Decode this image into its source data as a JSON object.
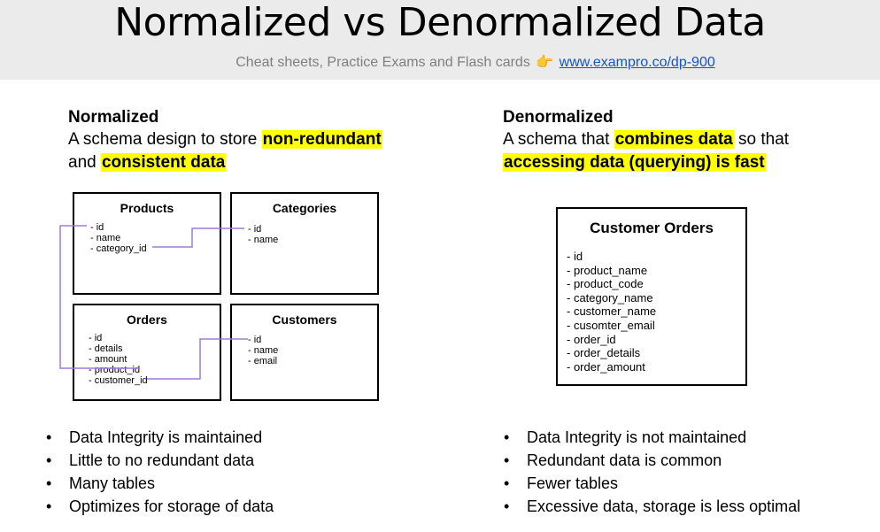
{
  "header": {
    "title": "Normalized vs Denormalized Data",
    "subtitle_text": "Cheat sheets, Practice Exams and Flash cards",
    "subtitle_icon": "pointing-hand-icon",
    "subtitle_link": "www.exampro.co/dp-900"
  },
  "left": {
    "heading": "Normalized",
    "desc_part1": "A schema design to store ",
    "desc_highlight1": "non-redundant",
    "desc_part2": "and ",
    "desc_highlight2": "consistent data",
    "tables": {
      "products": {
        "title": "Products",
        "fields": [
          "id",
          "name",
          "category_id"
        ]
      },
      "categories": {
        "title": "Categories",
        "fields": [
          "id",
          "name"
        ]
      },
      "orders": {
        "title": "Orders",
        "fields": [
          "id",
          "details",
          "amount",
          "product_id",
          "customer_id"
        ]
      },
      "customers": {
        "title": "Customers",
        "fields": [
          "id",
          "name",
          "email"
        ]
      }
    },
    "bullets": [
      "Data Integrity is maintained",
      "Little to no redundant data",
      "Many tables",
      "Optimizes for storage of data"
    ]
  },
  "right": {
    "heading": "Denormalized",
    "desc_part1": "A schema that ",
    "desc_highlight1": "combines data",
    "desc_part2": " so that",
    "desc_highlight2": "accessing data (querying) is fast",
    "table": {
      "title": "Customer Orders",
      "fields": [
        "id",
        "product_name",
        "product_code",
        "category_name",
        "customer_name",
        "cusomter_email",
        "order_id",
        "order_details",
        "order_amount"
      ]
    },
    "bullets": [
      "Data Integrity is not maintained",
      "Redundant data is common",
      "Fewer tables",
      "Excessive data, storage is less optimal"
    ]
  },
  "colors": {
    "highlight": "#ffff00",
    "connector": "#a07ad8",
    "header_bg": "#ebebeb",
    "link": "#1155cc"
  }
}
